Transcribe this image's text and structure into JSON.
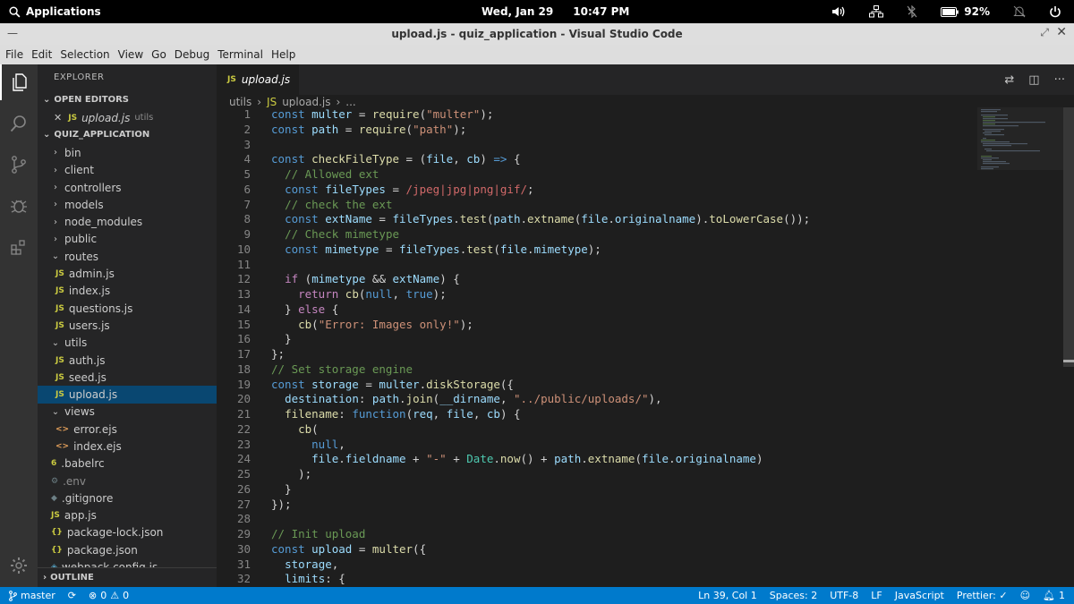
{
  "system": {
    "applications": "Applications",
    "date": "Wed, Jan 29",
    "time": "10:47 PM",
    "battery": "92%"
  },
  "window": {
    "title": "upload.js - quiz_application - Visual Studio Code"
  },
  "menu": [
    "File",
    "Edit",
    "Selection",
    "View",
    "Go",
    "Debug",
    "Terminal",
    "Help"
  ],
  "explorer": {
    "title": "EXPLORER",
    "open_editors_label": "OPEN EDITORS",
    "open_editor": {
      "name": "upload.js",
      "folder": "utils"
    },
    "project_label": "QUIZ_APPLICATION",
    "tree": [
      {
        "name": "bin",
        "type": "folder",
        "depth": 0,
        "open": false
      },
      {
        "name": "client",
        "type": "folder",
        "depth": 0,
        "open": false
      },
      {
        "name": "controllers",
        "type": "folder",
        "depth": 0,
        "open": false
      },
      {
        "name": "models",
        "type": "folder",
        "depth": 0,
        "open": false
      },
      {
        "name": "node_modules",
        "type": "folder",
        "depth": 0,
        "open": false
      },
      {
        "name": "public",
        "type": "folder",
        "depth": 0,
        "open": false
      },
      {
        "name": "routes",
        "type": "folder",
        "depth": 0,
        "open": true
      },
      {
        "name": "admin.js",
        "type": "js",
        "depth": 1
      },
      {
        "name": "index.js",
        "type": "js",
        "depth": 1
      },
      {
        "name": "questions.js",
        "type": "js",
        "depth": 1
      },
      {
        "name": "users.js",
        "type": "js",
        "depth": 1
      },
      {
        "name": "utils",
        "type": "folder",
        "depth": 0,
        "open": true
      },
      {
        "name": "auth.js",
        "type": "js",
        "depth": 1
      },
      {
        "name": "seed.js",
        "type": "js",
        "depth": 1
      },
      {
        "name": "upload.js",
        "type": "js",
        "depth": 1,
        "selected": true
      },
      {
        "name": "views",
        "type": "folder",
        "depth": 0,
        "open": true
      },
      {
        "name": "error.ejs",
        "type": "ejs",
        "depth": 1
      },
      {
        "name": "index.ejs",
        "type": "ejs",
        "depth": 1
      },
      {
        "name": ".babelrc",
        "type": "babel",
        "depth": 0
      },
      {
        "name": ".env",
        "type": "env",
        "depth": 0,
        "dim": true
      },
      {
        "name": ".gitignore",
        "type": "git",
        "depth": 0
      },
      {
        "name": "app.js",
        "type": "js",
        "depth": 0
      },
      {
        "name": "package-lock.json",
        "type": "json",
        "depth": 0
      },
      {
        "name": "package.json",
        "type": "json",
        "depth": 0
      },
      {
        "name": "webpack.config.js",
        "type": "wp",
        "depth": 0
      }
    ],
    "outline_label": "OUTLINE"
  },
  "editor": {
    "tab_label": "upload.js",
    "breadcrumb": [
      "utils",
      "upload.js",
      "..."
    ],
    "lines": [
      [
        [
          "k",
          "const "
        ],
        [
          "v",
          "multer"
        ],
        [
          "p",
          " = "
        ],
        [
          "f",
          "require"
        ],
        [
          "p",
          "("
        ],
        [
          "s",
          "\"multer\""
        ],
        [
          "p",
          ");"
        ]
      ],
      [
        [
          "k",
          "const "
        ],
        [
          "v",
          "path"
        ],
        [
          "p",
          " = "
        ],
        [
          "f",
          "require"
        ],
        [
          "p",
          "("
        ],
        [
          "s",
          "\"path\""
        ],
        [
          "p",
          ");"
        ]
      ],
      [],
      [
        [
          "k",
          "const "
        ],
        [
          "f",
          "checkFileType"
        ],
        [
          "p",
          " = ("
        ],
        [
          "v",
          "file"
        ],
        [
          "p",
          ", "
        ],
        [
          "v",
          "cb"
        ],
        [
          "p",
          ") "
        ],
        [
          "k",
          "=>"
        ],
        [
          "p",
          " {"
        ]
      ],
      [
        [
          "p",
          "  "
        ],
        [
          "c",
          "// Allowed ext"
        ]
      ],
      [
        [
          "p",
          "  "
        ],
        [
          "k",
          "const "
        ],
        [
          "v",
          "fileTypes"
        ],
        [
          "p",
          " = "
        ],
        [
          "r",
          "/jpeg|jpg|png|gif/"
        ],
        [
          "p",
          ";"
        ]
      ],
      [
        [
          "p",
          "  "
        ],
        [
          "c",
          "// check the ext"
        ]
      ],
      [
        [
          "p",
          "  "
        ],
        [
          "k",
          "const "
        ],
        [
          "v",
          "extName"
        ],
        [
          "p",
          " = "
        ],
        [
          "v",
          "fileTypes"
        ],
        [
          "p",
          "."
        ],
        [
          "f",
          "test"
        ],
        [
          "p",
          "("
        ],
        [
          "v",
          "path"
        ],
        [
          "p",
          "."
        ],
        [
          "f",
          "extname"
        ],
        [
          "p",
          "("
        ],
        [
          "v",
          "file"
        ],
        [
          "p",
          "."
        ],
        [
          "v",
          "originalname"
        ],
        [
          "p",
          ")."
        ],
        [
          "f",
          "toLowerCase"
        ],
        [
          "p",
          "());"
        ]
      ],
      [
        [
          "p",
          "  "
        ],
        [
          "c",
          "// Check mimetype"
        ]
      ],
      [
        [
          "p",
          "  "
        ],
        [
          "k",
          "const "
        ],
        [
          "v",
          "mimetype"
        ],
        [
          "p",
          " = "
        ],
        [
          "v",
          "fileTypes"
        ],
        [
          "p",
          "."
        ],
        [
          "f",
          "test"
        ],
        [
          "p",
          "("
        ],
        [
          "v",
          "file"
        ],
        [
          "p",
          "."
        ],
        [
          "v",
          "mimetype"
        ],
        [
          "p",
          ");"
        ]
      ],
      [],
      [
        [
          "p",
          "  "
        ],
        [
          "kc",
          "if"
        ],
        [
          "p",
          " ("
        ],
        [
          "v",
          "mimetype"
        ],
        [
          "p",
          " && "
        ],
        [
          "v",
          "extName"
        ],
        [
          "p",
          ") {"
        ]
      ],
      [
        [
          "p",
          "    "
        ],
        [
          "kc",
          "return "
        ],
        [
          "f",
          "cb"
        ],
        [
          "p",
          "("
        ],
        [
          "k",
          "null"
        ],
        [
          "p",
          ", "
        ],
        [
          "k",
          "true"
        ],
        [
          "p",
          ");"
        ]
      ],
      [
        [
          "p",
          "  } "
        ],
        [
          "kc",
          "else"
        ],
        [
          "p",
          " {"
        ]
      ],
      [
        [
          "p",
          "    "
        ],
        [
          "f",
          "cb"
        ],
        [
          "p",
          "("
        ],
        [
          "s",
          "\"Error: Images only!\""
        ],
        [
          "p",
          ");"
        ]
      ],
      [
        [
          "p",
          "  }"
        ]
      ],
      [
        [
          "p",
          "};"
        ]
      ],
      [
        [
          "c",
          "// Set storage engine"
        ]
      ],
      [
        [
          "k",
          "const "
        ],
        [
          "v",
          "storage"
        ],
        [
          "p",
          " = "
        ],
        [
          "v",
          "multer"
        ],
        [
          "p",
          "."
        ],
        [
          "f",
          "diskStorage"
        ],
        [
          "p",
          "({"
        ]
      ],
      [
        [
          "p",
          "  "
        ],
        [
          "v",
          "destination"
        ],
        [
          "p",
          ": "
        ],
        [
          "v",
          "path"
        ],
        [
          "p",
          "."
        ],
        [
          "f",
          "join"
        ],
        [
          "p",
          "("
        ],
        [
          "v",
          "__dirname"
        ],
        [
          "p",
          ", "
        ],
        [
          "s",
          "\"../public/uploads/\""
        ],
        [
          "p",
          "),"
        ]
      ],
      [
        [
          "p",
          "  "
        ],
        [
          "f",
          "filename"
        ],
        [
          "p",
          ": "
        ],
        [
          "k",
          "function"
        ],
        [
          "p",
          "("
        ],
        [
          "v",
          "req"
        ],
        [
          "p",
          ", "
        ],
        [
          "v",
          "file"
        ],
        [
          "p",
          ", "
        ],
        [
          "v",
          "cb"
        ],
        [
          "p",
          ") {"
        ]
      ],
      [
        [
          "p",
          "    "
        ],
        [
          "f",
          "cb"
        ],
        [
          "p",
          "("
        ]
      ],
      [
        [
          "p",
          "      "
        ],
        [
          "k",
          "null"
        ],
        [
          "p",
          ","
        ]
      ],
      [
        [
          "p",
          "      "
        ],
        [
          "v",
          "file"
        ],
        [
          "p",
          "."
        ],
        [
          "v",
          "fieldname"
        ],
        [
          "p",
          " + "
        ],
        [
          "s",
          "\"-\""
        ],
        [
          "p",
          " + "
        ],
        [
          "cls",
          "Date"
        ],
        [
          "p",
          "."
        ],
        [
          "f",
          "now"
        ],
        [
          "p",
          "() + "
        ],
        [
          "v",
          "path"
        ],
        [
          "p",
          "."
        ],
        [
          "f",
          "extname"
        ],
        [
          "p",
          "("
        ],
        [
          "v",
          "file"
        ],
        [
          "p",
          "."
        ],
        [
          "v",
          "originalname"
        ],
        [
          "p",
          ")"
        ]
      ],
      [
        [
          "p",
          "    );"
        ]
      ],
      [
        [
          "p",
          "  }"
        ]
      ],
      [
        [
          "p",
          "});"
        ]
      ],
      [],
      [
        [
          "c",
          "// Init upload"
        ]
      ],
      [
        [
          "k",
          "const "
        ],
        [
          "v",
          "upload"
        ],
        [
          "p",
          " = "
        ],
        [
          "f",
          "multer"
        ],
        [
          "p",
          "({"
        ]
      ],
      [
        [
          "p",
          "  "
        ],
        [
          "v",
          "storage"
        ],
        [
          "p",
          ","
        ]
      ],
      [
        [
          "p",
          "  "
        ],
        [
          "v",
          "limits"
        ],
        [
          "p",
          ": {"
        ]
      ]
    ]
  },
  "status": {
    "branch": "master",
    "errors": "0",
    "warnings": "0",
    "position": "Ln 39, Col 1",
    "spaces": "Spaces: 2",
    "encoding": "UTF-8",
    "eol": "LF",
    "language": "JavaScript",
    "prettier": "Prettier: ✓",
    "notifications": "1"
  }
}
